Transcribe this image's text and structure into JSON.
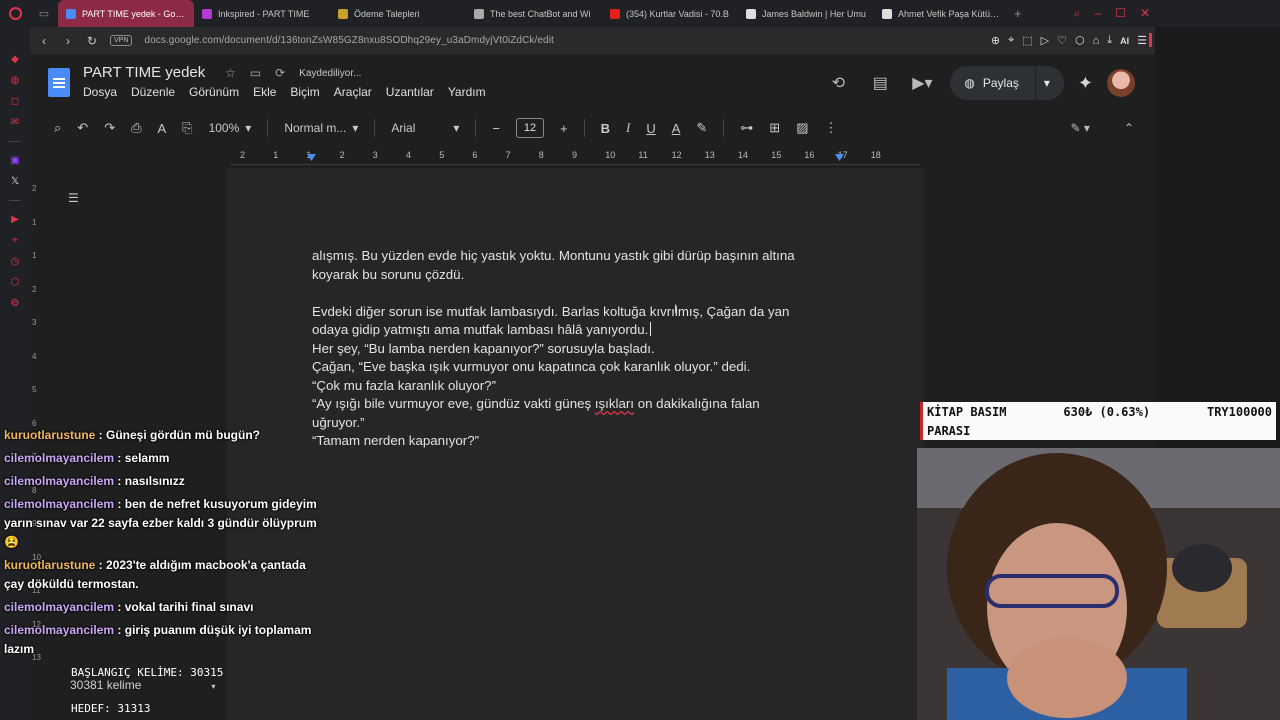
{
  "browser": {
    "tabs": [
      {
        "label": "PART TIME yedek - Google",
        "active": true,
        "color": "#4a8cf7"
      },
      {
        "label": "Inkspired - PART TIME",
        "active": false,
        "color": "#b23bd6"
      },
      {
        "label": "Ödeme Talepleri",
        "active": false,
        "color": "#c9a12f"
      },
      {
        "label": "The best ChatBot and Wi",
        "active": false,
        "color": "#aaaaaa"
      },
      {
        "label": "(354) Kurtlar Vadisi - 70.B",
        "active": false,
        "color": "#e62117"
      },
      {
        "label": "James Baldwin | Her Umu",
        "active": false,
        "color": "#dddddd"
      },
      {
        "label": "Ahmet Vefik Paşa Kütüpha",
        "active": false,
        "color": "#dddddd"
      }
    ],
    "vpn": "VPN",
    "url": "docs.google.com/document/d/136tonZsW85GZ8nxu8SODhq29ey_u3aDmdyjVt0iZdCk/edit",
    "ai_label": "AI",
    "accent": "#e0334d"
  },
  "docs": {
    "title": "PART TIME yedek",
    "saving_status": "Kaydediliyor...",
    "menu": [
      "Dosya",
      "Düzenle",
      "Görünüm",
      "Ekle",
      "Biçim",
      "Araçlar",
      "Uzantılar",
      "Yardım"
    ],
    "share_label": "Paylaş",
    "zoom": "100%",
    "style": "Normal m...",
    "font": "Arial",
    "font_size": "12",
    "ruler_labels": [
      "2",
      "1",
      "1",
      "2",
      "3",
      "4",
      "5",
      "6",
      "7",
      "8",
      "9",
      "10",
      "11",
      "12",
      "13",
      "14",
      "15",
      "16",
      "17",
      "18"
    ],
    "vruler_labels": [
      "2",
      "1",
      "1",
      "2",
      "3",
      "4",
      "5",
      "6",
      "7",
      "8",
      "9",
      "10",
      "11",
      "12",
      "13"
    ]
  },
  "document": {
    "lines": [
      "alışmış. Bu yüzden evde hiç yastık yoktu. Montunu yastık gibi dürüp başının altına",
      "koyarak bu sorunu çözdü.",
      "",
      "Evdeki diğer sorun ise mutfak lambasıydı. Barlas koltuğa kıvrılmış, Çağan da yan",
      "odaya gidip yatmıştı ama mutfak lambası hâlâ yanıyordu.",
      " Her şey, “Bu lamba nerden kapanıyor?” sorusuyla başladı.",
      "Çağan, “Eve başka ışık vurmuyor onu kapatınca çok karanlık oluyor.” dedi.",
      "“Çok mu fazla karanlık oluyor?”",
      "“Ay ışığı bile vurmuyor eve, gündüz vakti güneş ",
      "ışıkları",
      " on dakikalığına falan",
      "uğruyor.”",
      "“Tamam nerden kapanıyor?”"
    ]
  },
  "chat": [
    {
      "user": "kuruotlarustune",
      "color": "orange",
      "text": "Güneşi gördün mü bugün?"
    },
    {
      "user": "cilemolmayancilem",
      "color": "purple",
      "text": "selamm"
    },
    {
      "user": "cilemolmayancilem",
      "color": "purple",
      "text": "nasılsınızz"
    },
    {
      "user": "cilemolmayancilem",
      "color": "purple",
      "text": "ben de nefret kusuyorum gideyim yarın sınav var 22 sayfa ezber kaldı 3 gündür ölüyprum 😫"
    },
    {
      "user": "kuruotlarustune",
      "color": "orange",
      "text": "2023'te aldığım macbook'a çantada çay döküldü termostan."
    },
    {
      "user": "cilemolmayancilem",
      "color": "purple",
      "text": "vokal tarihi final sınavı"
    },
    {
      "user": "cilemolmayancilem",
      "color": "purple",
      "text": "giriş puanım düşük iyi toplamam lazım"
    }
  ],
  "overlay": {
    "start_words": "BAŞLANGIÇ KELİME: 30315",
    "word_count": "30381 kelime",
    "target": "HEDEF: 31313",
    "ticker_name": "KİTAP BASIM",
    "ticker_name2": "PARASI",
    "ticker_value": "630₺ (0.63%)",
    "ticker_goal": "TRY100000"
  }
}
